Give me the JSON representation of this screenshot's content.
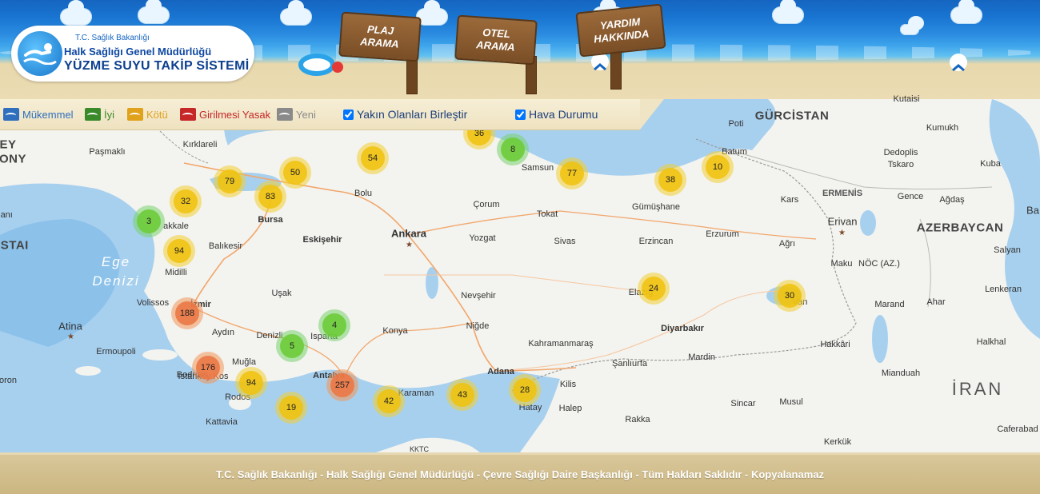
{
  "logo": {
    "ministry": "T.C. Sağlık Bakanlığı",
    "directorate": "Halk Sağlığı Genel Müdürlüğü",
    "system": "YÜZME SUYU TAKİP SİSTEMİ"
  },
  "nav": [
    {
      "label": "PLAJ ARAMA"
    },
    {
      "label": "OTEL ARAMA"
    },
    {
      "label": "YARDIM HAKKINDA"
    }
  ],
  "legend": {
    "items": [
      {
        "label": "Mükemmel",
        "color": "#2f6fbd"
      },
      {
        "label": "İyi",
        "color": "#3a8a2a"
      },
      {
        "label": "Kötü",
        "color": "#e0a11b"
      },
      {
        "label": "Girilmesi Yasak",
        "color": "#c62828"
      },
      {
        "label": "Yeni",
        "color": "#8a8a8a"
      }
    ],
    "merge_label": "Yakın Olanları Birleştir",
    "merge_checked": true,
    "weather_label": "Hava Durumu",
    "weather_checked": true
  },
  "map": {
    "labels": [
      {
        "text": "GÜRCİSTAN",
        "type": "country"
      },
      {
        "text": "ERMENİS",
        "type": "country-small"
      },
      {
        "text": "AZERBAYCAN",
        "type": "country"
      },
      {
        "text": "İRAN",
        "type": "country-big"
      },
      {
        "text": "Ege",
        "type": "sea"
      },
      {
        "text": "Denizi",
        "type": "sea"
      },
      {
        "text": "EY",
        "type": "country"
      },
      {
        "text": "ONY",
        "type": "country"
      },
      {
        "text": "ISTAI",
        "type": "country"
      },
      {
        "text": "Kutaisi",
        "type": "city"
      },
      {
        "text": "Poti",
        "type": "city"
      },
      {
        "text": "Kumukh",
        "type": "city"
      },
      {
        "text": "Batum",
        "type": "city"
      },
      {
        "text": "Dedoplis",
        "type": "city"
      },
      {
        "text": "Tskaro",
        "type": "city"
      },
      {
        "text": "Kuba",
        "type": "city"
      },
      {
        "text": "Gence",
        "type": "city"
      },
      {
        "text": "Ağdaş",
        "type": "city"
      },
      {
        "text": "Kars",
        "type": "city"
      },
      {
        "text": "Erivan",
        "type": "city"
      },
      {
        "text": "Ağrı",
        "type": "city"
      },
      {
        "text": "Maku",
        "type": "city"
      },
      {
        "text": "NÖC (AZ.)",
        "type": "city"
      },
      {
        "text": "Salyan",
        "type": "city"
      },
      {
        "text": "Lenkeran",
        "type": "city"
      },
      {
        "text": "Ba",
        "type": "city"
      },
      {
        "text": "Marand",
        "type": "city"
      },
      {
        "text": "Ahar",
        "type": "city"
      },
      {
        "text": "Halkhal",
        "type": "city"
      },
      {
        "text": "Mianduah",
        "type": "city"
      },
      {
        "text": "Caferabad",
        "type": "city"
      },
      {
        "text": "Kerkük",
        "type": "city"
      },
      {
        "text": "Musul",
        "type": "city"
      },
      {
        "text": "Sincar",
        "type": "city"
      },
      {
        "text": "Hakkâri",
        "type": "city"
      },
      {
        "text": "Mardin",
        "type": "city"
      },
      {
        "text": "Diyarbakır",
        "type": "city-bold"
      },
      {
        "text": "Şanlıurfa",
        "type": "city"
      },
      {
        "text": "Kahramanmaraş",
        "type": "city"
      },
      {
        "text": "Adana",
        "type": "city-bold"
      },
      {
        "text": "Niğde",
        "type": "city"
      },
      {
        "text": "Nevşehir",
        "type": "city"
      },
      {
        "text": "Konya",
        "type": "city"
      },
      {
        "text": "Ankara",
        "type": "capital"
      },
      {
        "text": "Yozgat",
        "type": "city"
      },
      {
        "text": "Sivas",
        "type": "city"
      },
      {
        "text": "Erzincan",
        "type": "city"
      },
      {
        "text": "Erzurum",
        "type": "city"
      },
      {
        "text": "Gümüşhane",
        "type": "city"
      },
      {
        "text": "Tokat",
        "type": "city"
      },
      {
        "text": "Çorum",
        "type": "city"
      },
      {
        "text": "Samsun",
        "type": "city"
      },
      {
        "text": "Bolu",
        "type": "city"
      },
      {
        "text": "Eskişehir",
        "type": "city-bold"
      },
      {
        "text": "Bursa",
        "type": "city-bold"
      },
      {
        "text": "Balıkesir",
        "type": "city"
      },
      {
        "text": "Kırklareli",
        "type": "city"
      },
      {
        "text": "Paşmaklı",
        "type": "city"
      },
      {
        "text": "Uşak",
        "type": "city"
      },
      {
        "text": "Aydın",
        "type": "city"
      },
      {
        "text": "İzmir",
        "type": "city-bold"
      },
      {
        "text": "Volissos",
        "type": "city"
      },
      {
        "text": "Midilli",
        "type": "city"
      },
      {
        "text": "akkale",
        "type": "city"
      },
      {
        "text": "lanı",
        "type": "city"
      },
      {
        "text": "Atina",
        "type": "capital"
      },
      {
        "text": "Ermoupoli",
        "type": "city"
      },
      {
        "text": "İstanköy Kos",
        "type": "city"
      },
      {
        "text": "Rodos",
        "type": "city"
      },
      {
        "text": "Kattavia",
        "type": "city"
      },
      {
        "text": "Muğla",
        "type": "city"
      },
      {
        "text": "Denizli",
        "type": "city"
      },
      {
        "text": "Isparta",
        "type": "city"
      },
      {
        "text": "Antalya",
        "type": "city-bold"
      },
      {
        "text": "Kilis",
        "type": "city"
      },
      {
        "text": "Hatay",
        "type": "city"
      },
      {
        "text": "Halep",
        "type": "city"
      },
      {
        "text": "Rakka",
        "type": "city"
      },
      {
        "text": "Elazığ",
        "type": "city"
      },
      {
        "text": "Van",
        "type": "city"
      },
      {
        "text": "Bodrum",
        "type": "city"
      },
      {
        "text": "oron",
        "type": "city"
      },
      {
        "text": "Karaman",
        "type": "city"
      },
      {
        "text": "KKTC",
        "type": "city"
      }
    ],
    "clusters": [
      {
        "count": "36",
        "level": "y"
      },
      {
        "count": "8",
        "level": "g"
      },
      {
        "count": "54",
        "level": "y"
      },
      {
        "count": "77",
        "level": "y"
      },
      {
        "count": "38",
        "level": "y"
      },
      {
        "count": "10",
        "level": "y"
      },
      {
        "count": "50",
        "level": "y"
      },
      {
        "count": "79",
        "level": "y"
      },
      {
        "count": "83",
        "level": "y"
      },
      {
        "count": "32",
        "level": "y"
      },
      {
        "count": "3",
        "level": "g"
      },
      {
        "count": "94",
        "level": "y"
      },
      {
        "count": "24",
        "level": "y"
      },
      {
        "count": "30",
        "level": "y"
      },
      {
        "count": "188",
        "level": "o"
      },
      {
        "count": "4",
        "level": "g"
      },
      {
        "count": "5",
        "level": "g"
      },
      {
        "count": "176",
        "level": "o"
      },
      {
        "count": "94",
        "level": "y"
      },
      {
        "count": "257",
        "level": "o"
      },
      {
        "count": "42",
        "level": "y"
      },
      {
        "count": "43",
        "level": "y"
      },
      {
        "count": "28",
        "level": "y"
      },
      {
        "count": "19",
        "level": "y"
      }
    ]
  },
  "footer": {
    "text": "T.C. Sağlık Bakanlığı - Halk Sağlığı Genel Müdürlüğü - Çevre Sağlığı Daire Başkanlığı - Tüm Hakları Saklıdır - Kopyalanamaz"
  }
}
